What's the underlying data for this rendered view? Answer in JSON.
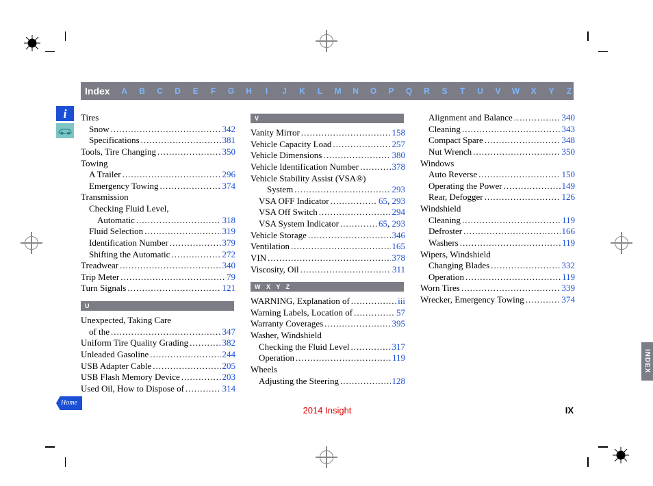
{
  "header": {
    "title": "Index",
    "letters": [
      "A",
      "B",
      "C",
      "D",
      "E",
      "F",
      "G",
      "H",
      "I",
      "J",
      "K",
      "L",
      "M",
      "N",
      "O",
      "P",
      "Q",
      "R",
      "S",
      "T",
      "U",
      "V",
      "W",
      "X",
      "Y",
      "Z"
    ]
  },
  "footer": {
    "center": "2014 Insight",
    "page_number": "IX"
  },
  "side_tab": "INDEX",
  "side_icons": {
    "info": "i",
    "home": "Home"
  },
  "sections": {
    "U": "U",
    "V": "V",
    "WXYZ": "W   X   Y   Z"
  },
  "col1": [
    {
      "label": "Tires",
      "page": "",
      "indent": 0
    },
    {
      "label": "Snow",
      "page": "342",
      "indent": 1
    },
    {
      "label": "Specifications",
      "page": "381",
      "indent": 1
    },
    {
      "label": "Tools, Tire Changing",
      "page": "350",
      "indent": 0
    },
    {
      "label": "Towing",
      "page": "",
      "indent": 0
    },
    {
      "label": "A Trailer",
      "page": "296",
      "indent": 1
    },
    {
      "label": "Emergency Towing",
      "page": "374",
      "indent": 1
    },
    {
      "label": "Transmission",
      "page": "",
      "indent": 0
    },
    {
      "label": "Checking Fluid Level,",
      "page": "",
      "indent": 1
    },
    {
      "label": "Automatic",
      "page": "318",
      "indent": 2
    },
    {
      "label": "Fluid Selection",
      "page": "319",
      "indent": 1
    },
    {
      "label": "Identification Number",
      "page": "379",
      "indent": 1
    },
    {
      "label": "Shifting the Automatic",
      "page": "272",
      "indent": 1
    },
    {
      "label": "Treadwear",
      "page": "340",
      "indent": 0
    },
    {
      "label": "Trip Meter",
      "page": "79",
      "indent": 0
    },
    {
      "label": "Turn Signals",
      "page": "121",
      "indent": 0
    }
  ],
  "col1b": [
    {
      "label": "Unexpected, Taking Care",
      "page": "",
      "indent": 0
    },
    {
      "label": "of the",
      "page": "347",
      "indent": 1
    },
    {
      "label": "Uniform Tire Quality Grading",
      "page": "382",
      "indent": 0
    },
    {
      "label": "Unleaded Gasoline",
      "page": "244",
      "indent": 0
    },
    {
      "label": "USB Adapter Cable",
      "page": "205",
      "indent": 0
    },
    {
      "label": "USB Flash Memory Device",
      "page": "203",
      "indent": 0
    },
    {
      "label": "Used Oil, How to Dispose of",
      "page": "314",
      "indent": 0
    }
  ],
  "col2a": [
    {
      "label": "Vanity Mirror",
      "page": "158",
      "indent": 0
    },
    {
      "label": "Vehicle Capacity Load",
      "page": "257",
      "indent": 0
    },
    {
      "label": "Vehicle Dimensions",
      "page": "380",
      "indent": 0
    },
    {
      "label": "Vehicle Identification Number",
      "page": "378",
      "indent": 0
    },
    {
      "label": "Vehicle Stability Assist (VSA®)",
      "page": "",
      "indent": 0
    },
    {
      "label": "System",
      "page": "293",
      "indent": 2
    },
    {
      "label": "VSA OFF Indicator",
      "page": "65, 293",
      "indent": 1
    },
    {
      "label": "VSA Off Switch",
      "page": "294",
      "indent": 1
    },
    {
      "label": "VSA System Indicator",
      "page": "65, 293",
      "indent": 1
    },
    {
      "label": "Vehicle Storage",
      "page": "346",
      "indent": 0
    },
    {
      "label": "Ventilation",
      "page": "165",
      "indent": 0
    },
    {
      "label": "VIN",
      "page": "378",
      "indent": 0
    },
    {
      "label": "Viscosity, Oil",
      "page": "311",
      "indent": 0
    }
  ],
  "col2b": [
    {
      "label": "WARNING, Explanation of",
      "page": "iii",
      "indent": 0
    },
    {
      "label": "Warning Labels, Location of",
      "page": "57",
      "indent": 0
    },
    {
      "label": "Warranty Coverages",
      "page": "395",
      "indent": 0
    },
    {
      "label": "Washer, Windshield",
      "page": "",
      "indent": 0
    },
    {
      "label": "Checking the Fluid Level",
      "page": "317",
      "indent": 1
    },
    {
      "label": "Operation",
      "page": "119",
      "indent": 1
    },
    {
      "label": "Wheels",
      "page": "",
      "indent": 0
    },
    {
      "label": "Adjusting the Steering",
      "page": "128",
      "indent": 1
    }
  ],
  "col3": [
    {
      "label": "Alignment and Balance",
      "page": "340",
      "indent": 1
    },
    {
      "label": "Cleaning",
      "page": "343",
      "indent": 1
    },
    {
      "label": "Compact Spare",
      "page": "348",
      "indent": 1
    },
    {
      "label": "Nut Wrench",
      "page": "350",
      "indent": 1
    },
    {
      "label": "Windows",
      "page": "",
      "indent": 0
    },
    {
      "label": "Auto Reverse",
      "page": "150",
      "indent": 1
    },
    {
      "label": "Operating the Power",
      "page": "149",
      "indent": 1
    },
    {
      "label": "Rear, Defogger",
      "page": "126",
      "indent": 1
    },
    {
      "label": "Windshield",
      "page": "",
      "indent": 0
    },
    {
      "label": "Cleaning",
      "page": "119",
      "indent": 1
    },
    {
      "label": "Defroster",
      "page": "166",
      "indent": 1
    },
    {
      "label": "Washers",
      "page": "119",
      "indent": 1
    },
    {
      "label": "Wipers, Windshield",
      "page": "",
      "indent": 0
    },
    {
      "label": "Changing Blades",
      "page": "332",
      "indent": 1
    },
    {
      "label": "Operation",
      "page": "119",
      "indent": 1
    },
    {
      "label": "Worn Tires",
      "page": "339",
      "indent": 0
    },
    {
      "label": "Wrecker, Emergency Towing",
      "page": "374",
      "indent": 0
    }
  ]
}
